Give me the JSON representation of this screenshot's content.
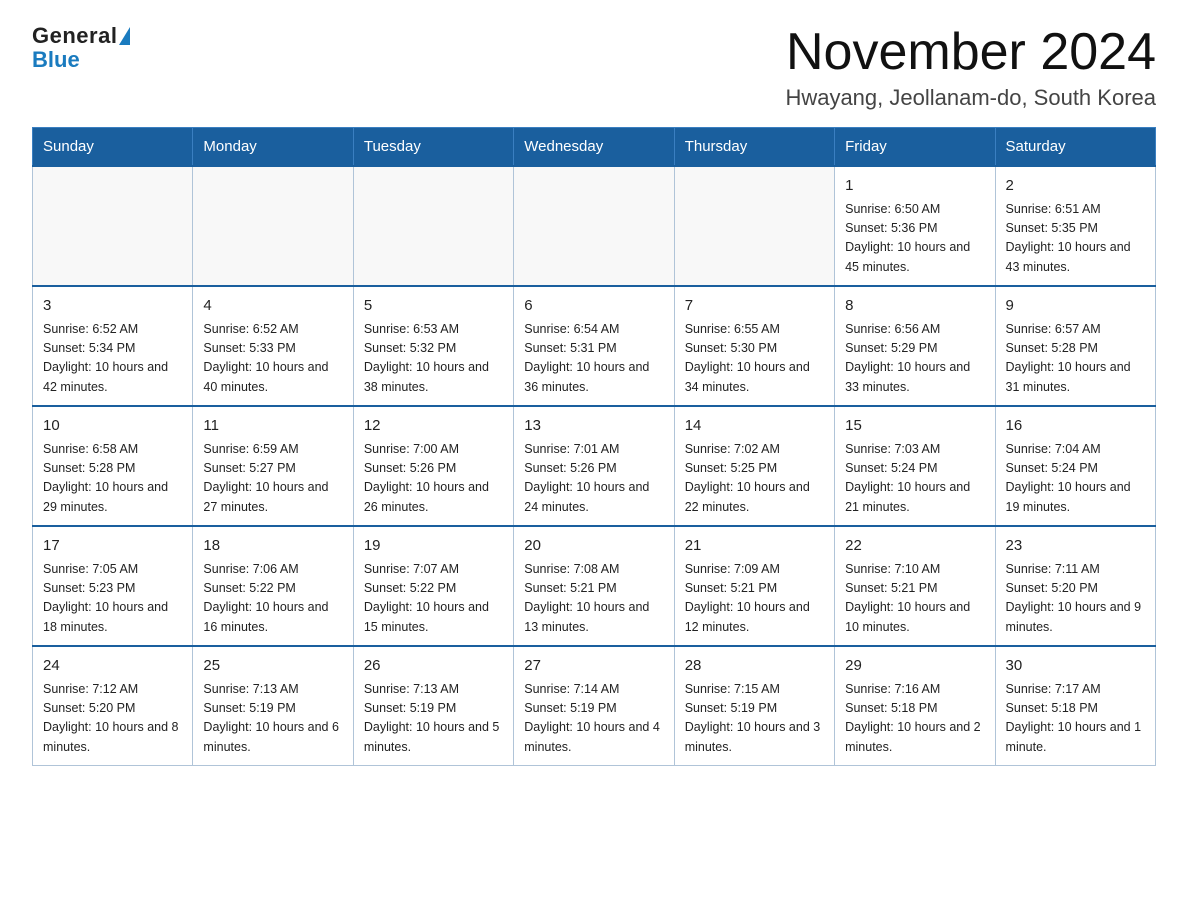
{
  "logo": {
    "general": "General",
    "blue": "Blue"
  },
  "title": "November 2024",
  "subtitle": "Hwayang, Jeollanam-do, South Korea",
  "weekdays": [
    "Sunday",
    "Monday",
    "Tuesday",
    "Wednesday",
    "Thursday",
    "Friday",
    "Saturday"
  ],
  "weeks": [
    [
      {
        "day": "",
        "info": ""
      },
      {
        "day": "",
        "info": ""
      },
      {
        "day": "",
        "info": ""
      },
      {
        "day": "",
        "info": ""
      },
      {
        "day": "",
        "info": ""
      },
      {
        "day": "1",
        "info": "Sunrise: 6:50 AM\nSunset: 5:36 PM\nDaylight: 10 hours and 45 minutes."
      },
      {
        "day": "2",
        "info": "Sunrise: 6:51 AM\nSunset: 5:35 PM\nDaylight: 10 hours and 43 minutes."
      }
    ],
    [
      {
        "day": "3",
        "info": "Sunrise: 6:52 AM\nSunset: 5:34 PM\nDaylight: 10 hours and 42 minutes."
      },
      {
        "day": "4",
        "info": "Sunrise: 6:52 AM\nSunset: 5:33 PM\nDaylight: 10 hours and 40 minutes."
      },
      {
        "day": "5",
        "info": "Sunrise: 6:53 AM\nSunset: 5:32 PM\nDaylight: 10 hours and 38 minutes."
      },
      {
        "day": "6",
        "info": "Sunrise: 6:54 AM\nSunset: 5:31 PM\nDaylight: 10 hours and 36 minutes."
      },
      {
        "day": "7",
        "info": "Sunrise: 6:55 AM\nSunset: 5:30 PM\nDaylight: 10 hours and 34 minutes."
      },
      {
        "day": "8",
        "info": "Sunrise: 6:56 AM\nSunset: 5:29 PM\nDaylight: 10 hours and 33 minutes."
      },
      {
        "day": "9",
        "info": "Sunrise: 6:57 AM\nSunset: 5:28 PM\nDaylight: 10 hours and 31 minutes."
      }
    ],
    [
      {
        "day": "10",
        "info": "Sunrise: 6:58 AM\nSunset: 5:28 PM\nDaylight: 10 hours and 29 minutes."
      },
      {
        "day": "11",
        "info": "Sunrise: 6:59 AM\nSunset: 5:27 PM\nDaylight: 10 hours and 27 minutes."
      },
      {
        "day": "12",
        "info": "Sunrise: 7:00 AM\nSunset: 5:26 PM\nDaylight: 10 hours and 26 minutes."
      },
      {
        "day": "13",
        "info": "Sunrise: 7:01 AM\nSunset: 5:26 PM\nDaylight: 10 hours and 24 minutes."
      },
      {
        "day": "14",
        "info": "Sunrise: 7:02 AM\nSunset: 5:25 PM\nDaylight: 10 hours and 22 minutes."
      },
      {
        "day": "15",
        "info": "Sunrise: 7:03 AM\nSunset: 5:24 PM\nDaylight: 10 hours and 21 minutes."
      },
      {
        "day": "16",
        "info": "Sunrise: 7:04 AM\nSunset: 5:24 PM\nDaylight: 10 hours and 19 minutes."
      }
    ],
    [
      {
        "day": "17",
        "info": "Sunrise: 7:05 AM\nSunset: 5:23 PM\nDaylight: 10 hours and 18 minutes."
      },
      {
        "day": "18",
        "info": "Sunrise: 7:06 AM\nSunset: 5:22 PM\nDaylight: 10 hours and 16 minutes."
      },
      {
        "day": "19",
        "info": "Sunrise: 7:07 AM\nSunset: 5:22 PM\nDaylight: 10 hours and 15 minutes."
      },
      {
        "day": "20",
        "info": "Sunrise: 7:08 AM\nSunset: 5:21 PM\nDaylight: 10 hours and 13 minutes."
      },
      {
        "day": "21",
        "info": "Sunrise: 7:09 AM\nSunset: 5:21 PM\nDaylight: 10 hours and 12 minutes."
      },
      {
        "day": "22",
        "info": "Sunrise: 7:10 AM\nSunset: 5:21 PM\nDaylight: 10 hours and 10 minutes."
      },
      {
        "day": "23",
        "info": "Sunrise: 7:11 AM\nSunset: 5:20 PM\nDaylight: 10 hours and 9 minutes."
      }
    ],
    [
      {
        "day": "24",
        "info": "Sunrise: 7:12 AM\nSunset: 5:20 PM\nDaylight: 10 hours and 8 minutes."
      },
      {
        "day": "25",
        "info": "Sunrise: 7:13 AM\nSunset: 5:19 PM\nDaylight: 10 hours and 6 minutes."
      },
      {
        "day": "26",
        "info": "Sunrise: 7:13 AM\nSunset: 5:19 PM\nDaylight: 10 hours and 5 minutes."
      },
      {
        "day": "27",
        "info": "Sunrise: 7:14 AM\nSunset: 5:19 PM\nDaylight: 10 hours and 4 minutes."
      },
      {
        "day": "28",
        "info": "Sunrise: 7:15 AM\nSunset: 5:19 PM\nDaylight: 10 hours and 3 minutes."
      },
      {
        "day": "29",
        "info": "Sunrise: 7:16 AM\nSunset: 5:18 PM\nDaylight: 10 hours and 2 minutes."
      },
      {
        "day": "30",
        "info": "Sunrise: 7:17 AM\nSunset: 5:18 PM\nDaylight: 10 hours and 1 minute."
      }
    ]
  ]
}
